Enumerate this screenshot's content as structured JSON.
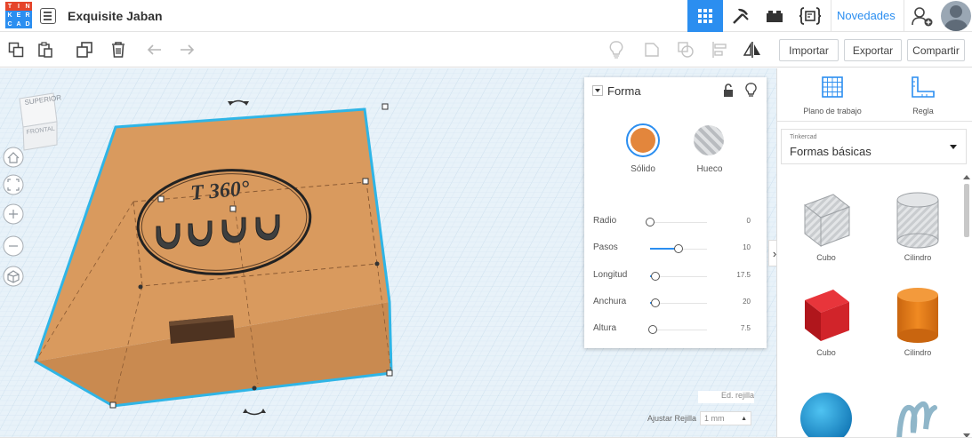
{
  "app": {
    "logo_letters": [
      "T",
      "I",
      "N",
      "K",
      "E",
      "R",
      "C",
      "A",
      "D"
    ],
    "logo_colors": [
      "#e5442a",
      "#e5442a",
      "#e5442a",
      "#2b8ef0",
      "#2b8ef0",
      "#2b8ef0",
      "#2b8ef0",
      "#2b8ef0",
      "#2b8ef0"
    ],
    "design_title": "Exquisite Jaban",
    "novedades_label": "Novedades",
    "accent_color": "#2b8ef0"
  },
  "topnav": {
    "icons": [
      "grid-view-icon",
      "pickaxe-icon",
      "brick-icon",
      "code-blocks-icon",
      "add-user-icon",
      "avatar"
    ]
  },
  "toolbar": {
    "left_icons": [
      "copy-icon",
      "paste-icon",
      "duplicate-icon",
      "delete-icon",
      "undo-icon",
      "redo-icon"
    ],
    "right_icons": [
      "note-icon",
      "comment-icon",
      "hide-icon",
      "align-icon",
      "mirror-icon"
    ],
    "importar_label": "Importar",
    "exportar_label": "Exportar",
    "compartir_label": "Compartir"
  },
  "viewcube": {
    "top_label": "SUPERIOR",
    "front_label": "FRONTAL"
  },
  "nav_controls": [
    "home-icon",
    "fit-icon",
    "zoom-in-icon",
    "zoom-out-icon",
    "perspective-icon"
  ],
  "model": {
    "engraving_text": "T 360°",
    "box_color": "#d99a5e"
  },
  "shape_panel": {
    "title": "Forma",
    "solid_label": "Sólido",
    "hole_label": "Hueco",
    "solid_color": "#e3863c",
    "properties": [
      {
        "label": "Radio",
        "value": "0",
        "level": 0
      },
      {
        "label": "Pasos",
        "value": "10",
        "level": 0.5
      },
      {
        "label": "Longitud",
        "value": "17.5",
        "level": 0.1
      },
      {
        "label": "Anchura",
        "value": "20",
        "level": 0.1
      },
      {
        "label": "Altura",
        "value": "7.5",
        "level": 0.05
      }
    ]
  },
  "grid_controls": {
    "edit_grid_label": "Ed. rejilla",
    "snap_label": "Ajustar Rejilla",
    "snap_value": "1 mm"
  },
  "right_panel": {
    "workplane_label": "Plano de trabajo",
    "ruler_label": "Regla",
    "library_small": "Tinkercad",
    "library_main": "Formas básicas",
    "shapes": [
      {
        "name": "Cubo",
        "icon": "striped-cube-icon"
      },
      {
        "name": "Cilindro",
        "icon": "striped-cylinder-icon"
      },
      {
        "name": "Cubo",
        "icon": "red-cube-icon"
      },
      {
        "name": "Cilindro",
        "icon": "orange-cylinder-icon"
      },
      {
        "name": "",
        "icon": "sphere-icon"
      },
      {
        "name": "",
        "icon": "scribble-icon"
      }
    ]
  }
}
